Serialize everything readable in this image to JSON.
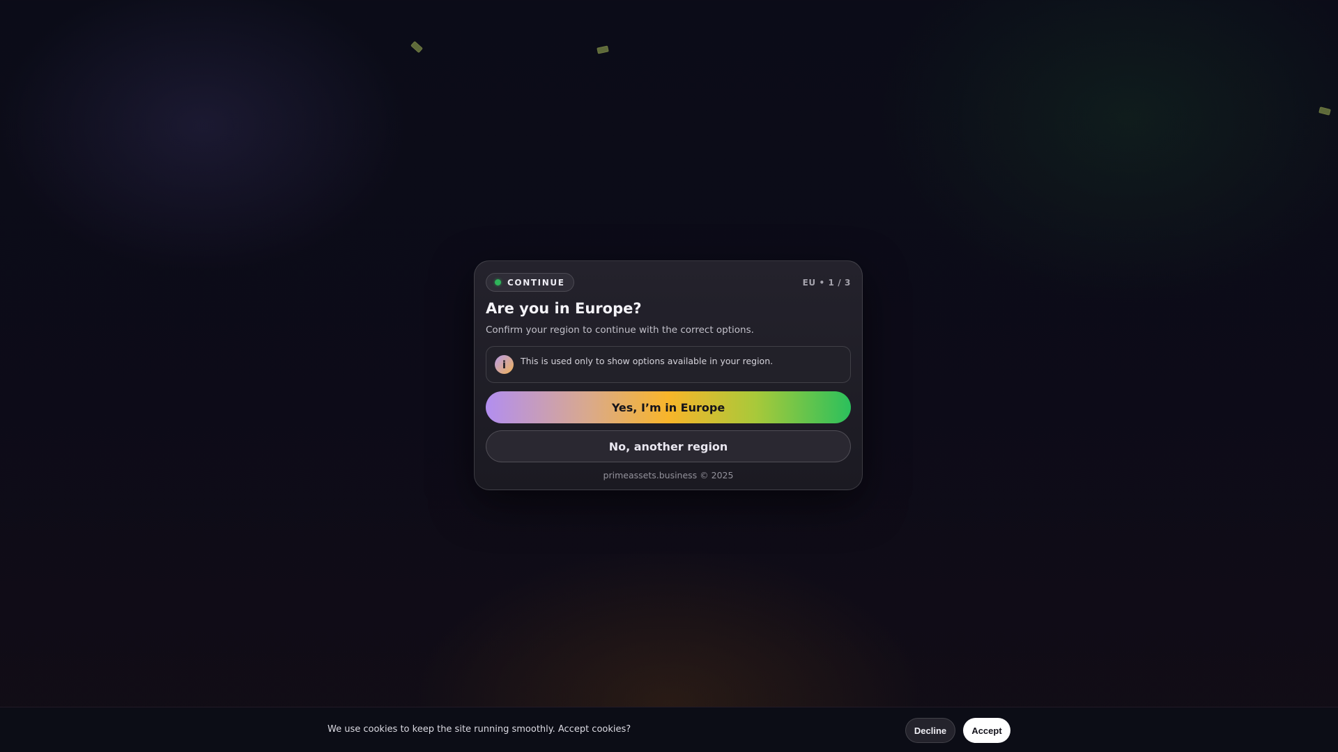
{
  "modal": {
    "pill": {
      "label": "CONTINUE",
      "status_color": "#2fb45a"
    },
    "step": "EU • 1 / 3",
    "title": "Are you in Europe?",
    "subtitle": "Confirm your region to continue with the correct options.",
    "info": {
      "icon": "info-icon",
      "icon_glyph": "i",
      "text": "This is used only to show options available in your region."
    },
    "primary_button": "Yes, I’m in Europe",
    "secondary_button": "No, another region",
    "footer": "primeassets.business © 2025"
  },
  "cookie_bar": {
    "text": "We use cookies to keep the site running smoothly. Accept cookies?",
    "decline_label": "Decline",
    "accept_label": "Accept"
  },
  "colors": {
    "background": "#0c0b17",
    "modal": "#1f1d26",
    "gradient_start": "#b28ef0",
    "gradient_mid": "#f8b52a",
    "gradient_end": "#2bc05c"
  }
}
